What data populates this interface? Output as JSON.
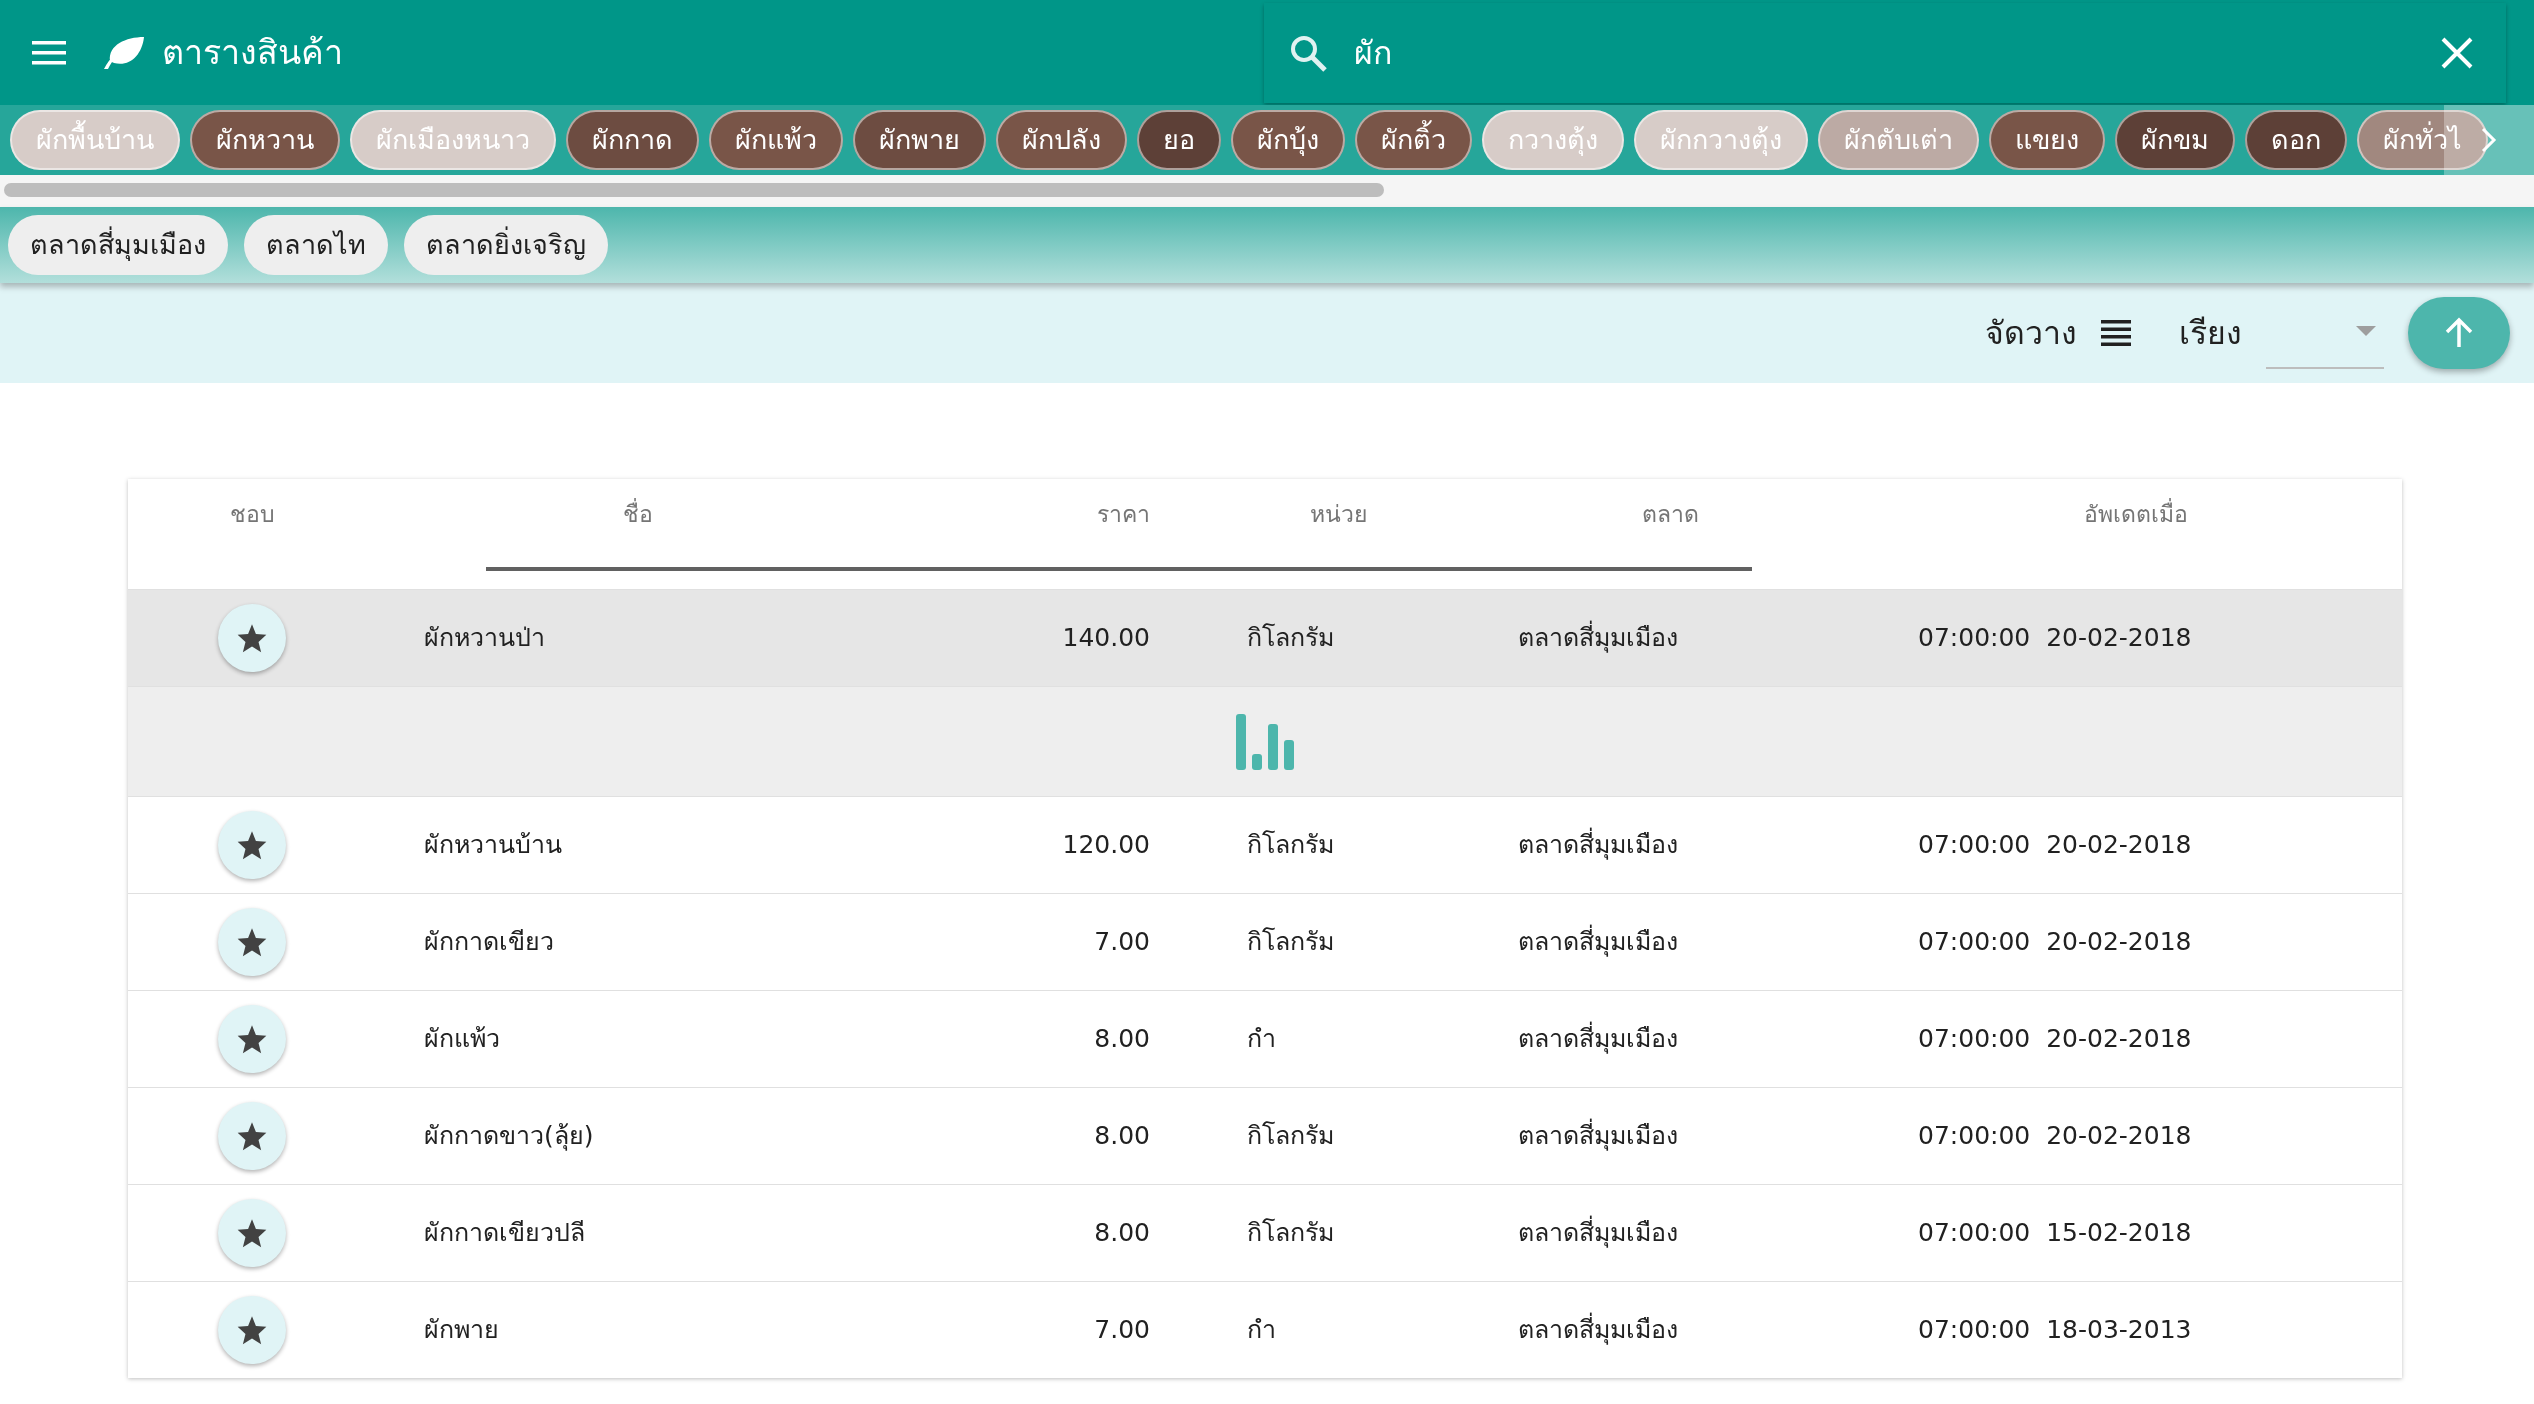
{
  "app_bar": {
    "title": "ตารางสินค้า",
    "search": {
      "value": "ผัก"
    }
  },
  "categories": [
    {
      "label": "ผักพื้นบ้าน",
      "color": "#d7ccc8"
    },
    {
      "label": "ผักหวาน",
      "color": "#795548"
    },
    {
      "label": "ผักเมืองหนาว",
      "color": "#d7ccc8"
    },
    {
      "label": "ผักกาด",
      "color": "#6d4c41"
    },
    {
      "label": "ผักแพ้ว",
      "color": "#795548"
    },
    {
      "label": "ผักพาย",
      "color": "#6d4c41"
    },
    {
      "label": "ผักปลัง",
      "color": "#795548"
    },
    {
      "label": "ยอ",
      "color": "#5d4037"
    },
    {
      "label": "ผักบุ้ง",
      "color": "#795548"
    },
    {
      "label": "ผักติ้ว",
      "color": "#795548"
    },
    {
      "label": "กวางตุ้ง",
      "color": "#d7ccc8"
    },
    {
      "label": "ผักกวางตุ้ง",
      "color": "#d7ccc8"
    },
    {
      "label": "ผักตับเต่า",
      "color": "#bcaaa4"
    },
    {
      "label": "แขยง",
      "color": "#795548"
    },
    {
      "label": "ผักขม",
      "color": "#5d4037"
    },
    {
      "label": "ดอก",
      "color": "#5d4037"
    },
    {
      "label": "ผักทั่วไ",
      "color": "#a1887f"
    }
  ],
  "markets": [
    "ตลาดสี่มุมเมือง",
    "ตลาดไท",
    "ตลาดยิ่งเจริญ"
  ],
  "toolbar": {
    "layout_label": "จัดวาง",
    "sort_label": "เรียง"
  },
  "table": {
    "columns": [
      "ชอบ",
      "ชื่อ",
      "ราคา",
      "หน่วย",
      "ตลาด",
      "อัพเดตเมื่อ"
    ],
    "rows": [
      {
        "kind": "item",
        "selected": true,
        "name": "ผักหวานป่า",
        "price": "140.00",
        "unit": "กิโลกรัม",
        "market": "ตลาดสี่มุมเมือง",
        "updated": "07:00:00  20-02-2018"
      },
      {
        "kind": "loading"
      },
      {
        "kind": "item",
        "selected": false,
        "name": "ผักหวานบ้าน",
        "price": "120.00",
        "unit": "กิโลกรัม",
        "market": "ตลาดสี่มุมเมือง",
        "updated": "07:00:00  20-02-2018"
      },
      {
        "kind": "item",
        "selected": false,
        "name": "ผักกาดเขียว",
        "price": "7.00",
        "unit": "กิโลกรัม",
        "market": "ตลาดสี่มุมเมือง",
        "updated": "07:00:00  20-02-2018"
      },
      {
        "kind": "item",
        "selected": false,
        "name": "ผักแพ้ว",
        "price": "8.00",
        "unit": "กำ",
        "market": "ตลาดสี่มุมเมือง",
        "updated": "07:00:00  20-02-2018"
      },
      {
        "kind": "item",
        "selected": false,
        "name": "ผักกาดขาว(ลุ้ย)",
        "price": "8.00",
        "unit": "กิโลกรัม",
        "market": "ตลาดสี่มุมเมือง",
        "updated": "07:00:00  20-02-2018"
      },
      {
        "kind": "item",
        "selected": false,
        "name": "ผักกาดเขียวปลี",
        "price": "8.00",
        "unit": "กิโลกรัม",
        "market": "ตลาดสี่มุมเมือง",
        "updated": "07:00:00  15-02-2018"
      },
      {
        "kind": "item",
        "selected": false,
        "name": "ผักพาย",
        "price": "7.00",
        "unit": "กำ",
        "market": "ตลาดสี่มุมเมือง",
        "updated": "07:00:00  18-03-2013"
      }
    ]
  }
}
